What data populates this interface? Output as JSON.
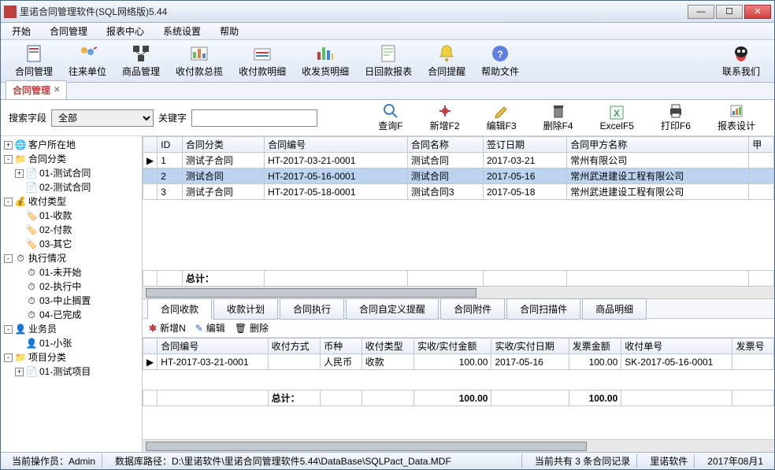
{
  "title": "里诺合同管理软件(SQL网络版)5.44",
  "menu": [
    "开始",
    "合同管理",
    "报表中心",
    "系统设置",
    "帮助"
  ],
  "toolbar": [
    {
      "name": "contract-mgmt",
      "label": "合同管理"
    },
    {
      "name": "partner",
      "label": "往来单位"
    },
    {
      "name": "goods",
      "label": "商品管理"
    },
    {
      "name": "pay-overview",
      "label": "收付款总揽"
    },
    {
      "name": "pay-detail",
      "label": "收付款明细"
    },
    {
      "name": "ship-detail",
      "label": "收发货明细"
    },
    {
      "name": "daily-report",
      "label": "日回款报表"
    },
    {
      "name": "contract-remind",
      "label": "合同提醒"
    },
    {
      "name": "help-doc",
      "label": "帮助文件"
    }
  ],
  "contact_us": "联系我们",
  "tab": {
    "label": "合同管理"
  },
  "search": {
    "field_label": "搜索字段",
    "field_value": "全部",
    "keyword_label": "关键字",
    "keyword_value": ""
  },
  "actions": [
    {
      "name": "query",
      "label": "查询F"
    },
    {
      "name": "add",
      "label": "新增F2"
    },
    {
      "name": "edit",
      "label": "编辑F3"
    },
    {
      "name": "delete",
      "label": "删除F4"
    },
    {
      "name": "excel",
      "label": "ExcelF5"
    },
    {
      "name": "print",
      "label": "打印F6"
    },
    {
      "name": "report-design",
      "label": "报表设计"
    }
  ],
  "tree": {
    "customer_loc": "客户所在地",
    "contract_cat": "合同分类",
    "cat1": "01-测试合同",
    "cat2": "02-测试合同",
    "pay_type": "收付类型",
    "pt1": "01-收款",
    "pt2": "02-付款",
    "pt3": "03-其它",
    "exec": "执行情况",
    "ex1": "01-未开始",
    "ex2": "02-执行中",
    "ex3": "03-中止搁置",
    "ex4": "04-已完成",
    "sales": "业务员",
    "s1": "01-小张",
    "proj": "项目分类",
    "p1": "01-测试项目"
  },
  "grid1": {
    "headers": [
      "ID",
      "合同分类",
      "合同编号",
      "合同名称",
      "签订日期",
      "合同甲方名称",
      "甲"
    ],
    "rows": [
      {
        "id": "1",
        "cat": "测试子合同",
        "no": "HT-2017-03-21-0001",
        "name": "测试合同",
        "date": "2017-03-21",
        "party": "常州有限公司"
      },
      {
        "id": "2",
        "cat": "测试合同",
        "no": "HT-2017-05-16-0001",
        "name": "测试合同",
        "date": "2017-05-16",
        "party": "常州武进建设工程有限公司",
        "sel": true
      },
      {
        "id": "3",
        "cat": "测试子合同",
        "no": "HT-2017-05-18-0001",
        "name": "测试合同3",
        "date": "2017-05-18",
        "party": "常州武进建设工程有限公司"
      }
    ],
    "total_label": "总计："
  },
  "subtabs": [
    "合同收款",
    "收款计划",
    "合同执行",
    "合同自定义提醒",
    "合同附件",
    "合同扫描件",
    "商品明细"
  ],
  "subtools": {
    "add": "新增N",
    "edit": "编辑",
    "del": "删除"
  },
  "grid2": {
    "headers": [
      "合同编号",
      "收付方式",
      "币种",
      "收付类型",
      "实收/实付金额",
      "实收/实付日期",
      "发票金额",
      "收付单号",
      "发票号"
    ],
    "rows": [
      {
        "no": "HT-2017-03-21-0001",
        "way": "",
        "cur": "人民币",
        "type": "收款",
        "amt": "100.00",
        "date": "2017-05-16",
        "inv": "100.00",
        "bill": "SK-2017-05-16-0001"
      }
    ],
    "total_label": "总计：",
    "total_amt": "100.00",
    "total_inv": "100.00"
  },
  "status": {
    "operator": "当前操作员：Admin",
    "dbpath": "数据库路径：D:\\里诺软件\\里诺合同管理软件5.44\\DataBase\\SQLPact_Data.MDF",
    "count": "当前共有 3 条合同记录",
    "brand": "里诺软件",
    "date": "2017年08月1"
  }
}
